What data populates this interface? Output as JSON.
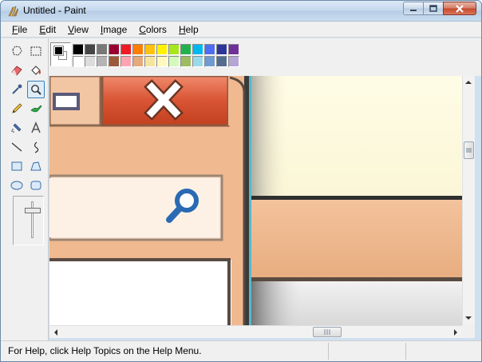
{
  "window": {
    "title": "Untitled - Paint",
    "icon": "paint-app-icon"
  },
  "caption_buttons": [
    "minimize",
    "maximize",
    "close"
  ],
  "menu": {
    "items": [
      {
        "label": "File",
        "mnemonic": "F",
        "rest": "ile"
      },
      {
        "label": "Edit",
        "mnemonic": "E",
        "rest": "dit"
      },
      {
        "label": "View",
        "mnemonic": "V",
        "rest": "iew"
      },
      {
        "label": "Image",
        "mnemonic": "I",
        "rest": "mage"
      },
      {
        "label": "Colors",
        "mnemonic": "C",
        "rest": "olors"
      },
      {
        "label": "Help",
        "mnemonic": "H",
        "rest": "elp"
      }
    ]
  },
  "toolbox": {
    "tools": [
      {
        "name": "free-form-select",
        "icon": "free-form-select-icon"
      },
      {
        "name": "select",
        "icon": "rect-select-icon"
      },
      {
        "name": "eraser",
        "icon": "eraser-icon"
      },
      {
        "name": "fill",
        "icon": "fill-bucket-icon"
      },
      {
        "name": "pick-color",
        "icon": "eyedropper-icon"
      },
      {
        "name": "magnifier",
        "icon": "magnifier-icon",
        "active": true
      },
      {
        "name": "pencil",
        "icon": "pencil-icon"
      },
      {
        "name": "brush",
        "icon": "brush-icon"
      },
      {
        "name": "airbrush",
        "icon": "airbrush-icon"
      },
      {
        "name": "text",
        "icon": "text-icon"
      },
      {
        "name": "line",
        "icon": "line-icon"
      },
      {
        "name": "curve",
        "icon": "curve-icon"
      },
      {
        "name": "rectangle",
        "icon": "rectangle-icon"
      },
      {
        "name": "polygon",
        "icon": "polygon-icon"
      },
      {
        "name": "ellipse",
        "icon": "ellipse-icon"
      },
      {
        "name": "rounded-rectangle",
        "icon": "rounded-rectangle-icon"
      }
    ]
  },
  "palette": {
    "foreground": "#000000",
    "background": "#ffffff",
    "row1": [
      "#000000",
      "#464646",
      "#787878",
      "#990030",
      "#ed1c24",
      "#ff7e00",
      "#ffc20e",
      "#fff200",
      "#a8e61d",
      "#22b14c",
      "#00b7ef",
      "#4d6df3",
      "#2f3699",
      "#6f3198"
    ],
    "row2": [
      "#ffffff",
      "#dcdcdc",
      "#b4b4b4",
      "#9c5a3c",
      "#ffa3b1",
      "#e5aa7a",
      "#f5e49c",
      "#fff9bd",
      "#d3f9bc",
      "#9dbb61",
      "#99d9ea",
      "#709ad1",
      "#546d8e",
      "#b5a5d5"
    ]
  },
  "canvas": {
    "description_icons": [
      "close-icon",
      "search-icon"
    ]
  },
  "statusbar": {
    "text": "For Help, click Help Topics on the Help Menu."
  }
}
